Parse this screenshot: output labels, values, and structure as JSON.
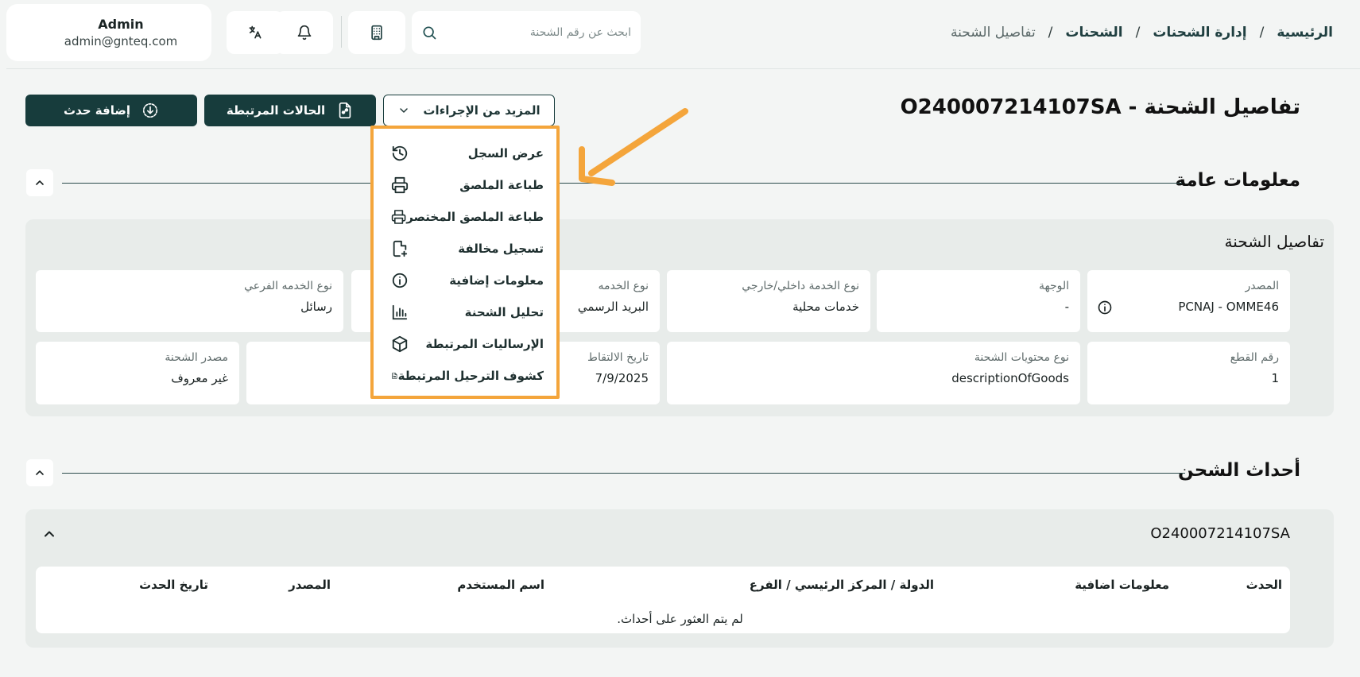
{
  "header": {
    "user": {
      "name": "Admin",
      "email": "admin@gnteq.com"
    },
    "search": {
      "placeholder": "ابحث عن رقم الشحنة"
    },
    "breadcrumb": [
      "الرئيسية",
      "إدارة الشحنات",
      "الشحنات",
      "تفاصيل الشحنة"
    ],
    "breadcrumb_separator": "/"
  },
  "page": {
    "title": "تفاصيل الشحنة - O240007214107SA",
    "buttons": {
      "add_event": "إضافة حدث",
      "linked_cases": "الحالات المرتبطة",
      "more_actions": "المزيد من الإجراءات"
    }
  },
  "more_actions_menu": [
    {
      "label": "عرض السجل",
      "icon": "history-icon"
    },
    {
      "label": "طباعة الملصق",
      "icon": "printer-icon"
    },
    {
      "label": "طباعة الملصق المختصر",
      "icon": "printer-icon"
    },
    {
      "label": "تسجيل مخالفة",
      "icon": "file-plus-icon"
    },
    {
      "label": "معلومات إضافية",
      "icon": "info-icon"
    },
    {
      "label": "تحليل الشحنة",
      "icon": "bar-chart-icon"
    },
    {
      "label": "الإرساليات المرتبطة",
      "icon": "package-icon"
    },
    {
      "label": "كشوف الترحيل المرتبطة",
      "icon": "document-icon"
    }
  ],
  "general_info": {
    "title": "معلومات عامة",
    "panel_title": "تفاصيل الشحنة",
    "row1": [
      {
        "label": "المصدر",
        "value": "PCNAJ - OMME46"
      },
      {
        "label": "الوجهة",
        "value": "-"
      },
      {
        "label": "نوع الخدمة داخلي/خارجي",
        "value": "خدمات محلية"
      },
      {
        "label": "نوع الخدمه",
        "value": "البريد الرسمي"
      },
      {
        "label": "نوع الخدمه الفرعي",
        "value": "رسائل"
      }
    ],
    "row2": [
      {
        "label": "رقم القطع",
        "value": "1"
      },
      {
        "label": "نوع محتويات الشحنة",
        "value": "descriptionOfGoods"
      },
      {
        "label": "تاريخ الالتقاط",
        "value": "7/9/2025"
      },
      {
        "label": "مصدر الشحنة",
        "value": "غير معروف"
      }
    ]
  },
  "shipping_events": {
    "title": "أحداث الشحن",
    "shipment_id": "O240007214107SA",
    "columns": [
      "الحدث",
      "معلومات اضافية",
      "الدولة / المركز الرئيسي / الفرع",
      "اسم المستخدم",
      "المصدر",
      "تاريخ الحدث"
    ],
    "empty_message": "لم يتم العثور على أحداث."
  },
  "colors": {
    "primary": "#173c3c",
    "highlight": "#f4a53b",
    "background": "#f3f5f4"
  }
}
